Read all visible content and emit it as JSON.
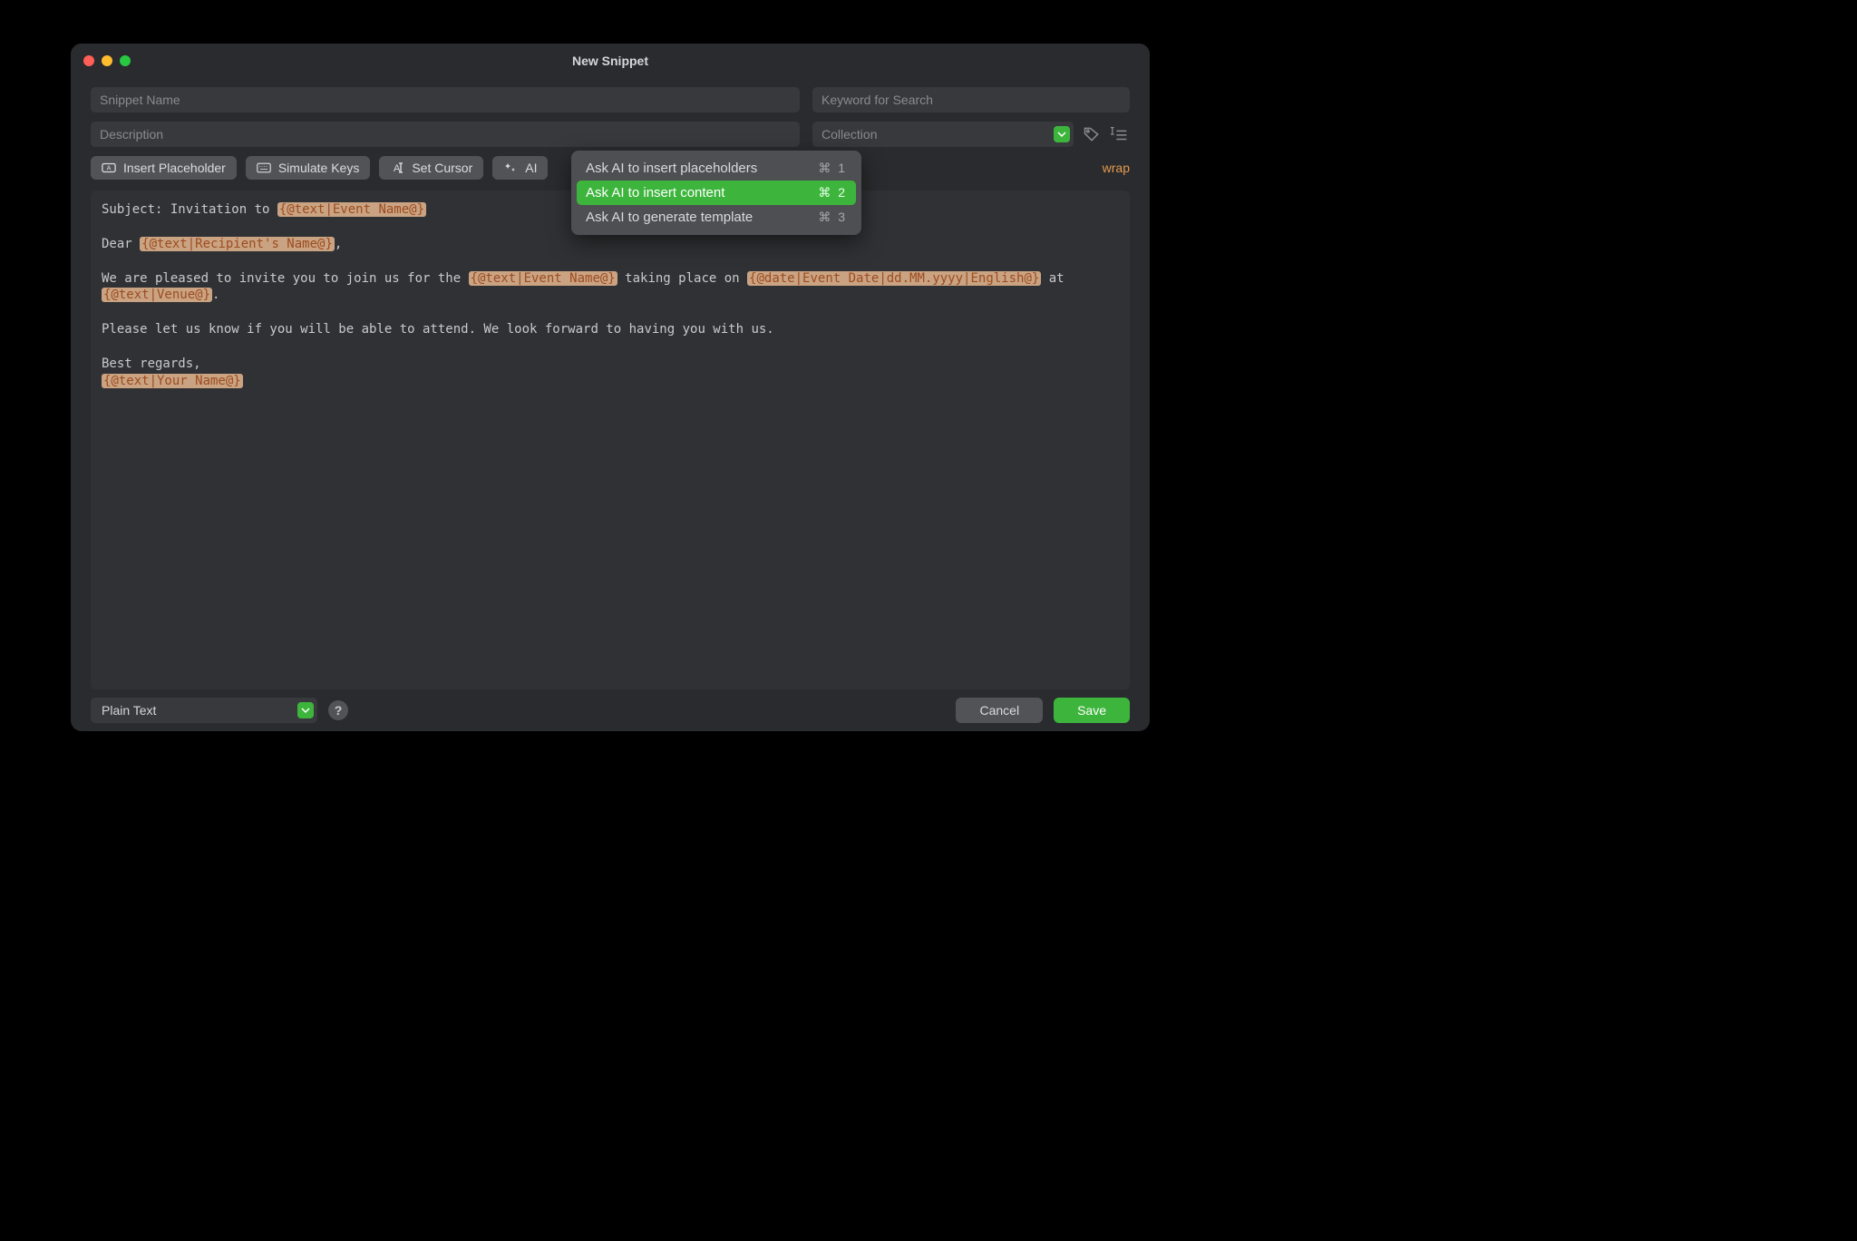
{
  "window": {
    "title": "New Snippet"
  },
  "inputs": {
    "name_placeholder": "Snippet Name",
    "keyword_placeholder": "Keyword for Search",
    "description_placeholder": "Description",
    "collection_placeholder": "Collection"
  },
  "toolbar": {
    "insert_placeholder": "Insert Placeholder",
    "simulate_keys": "Simulate Keys",
    "set_cursor": "Set Cursor",
    "ai": "AI",
    "wrap": "wrap"
  },
  "ai_menu": {
    "items": [
      {
        "label": "Ask AI to insert placeholders",
        "shortcut": "⌘ 1",
        "selected": false
      },
      {
        "label": "Ask AI to insert content",
        "shortcut": "⌘ 2",
        "selected": true
      },
      {
        "label": "Ask AI to generate template",
        "shortcut": "⌘ 3",
        "selected": false
      }
    ]
  },
  "editor": {
    "text1": "Subject: Invitation to ",
    "ph1": "{@text|Event Name@}",
    "text2": "Dear ",
    "ph2": "{@text|Recipient's Name@}",
    "text2b": ",",
    "text3": "We are pleased to invite you to join us for the ",
    "ph3": "{@text|Event Name@}",
    "text3b": " taking place on ",
    "ph4": "{@date|Event Date|dd.MM.yyyy|English@}",
    "text3c": " at ",
    "ph5": "{@text|Venue@}",
    "text3d": ".",
    "text4": "Please let us know if you will be able to attend. We look forward to having you with us.",
    "text5": "Best regards,",
    "ph6": "{@text|Your Name@}"
  },
  "footer": {
    "format": "Plain Text",
    "help": "?",
    "cancel": "Cancel",
    "save": "Save"
  }
}
